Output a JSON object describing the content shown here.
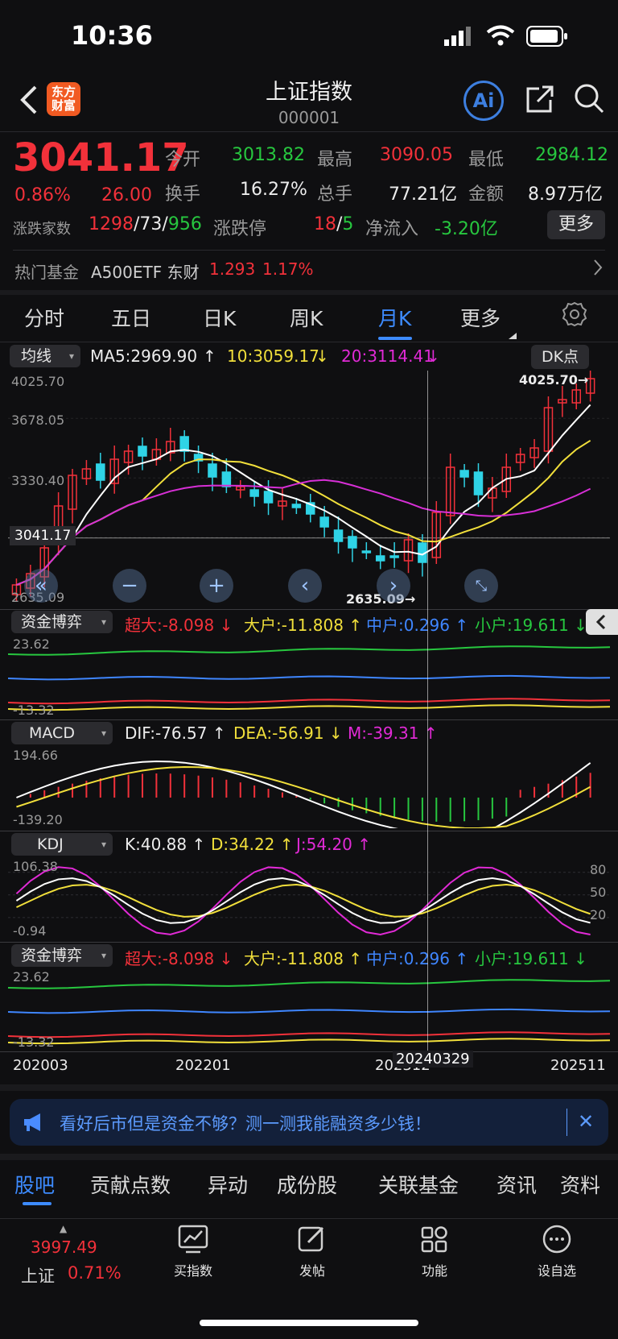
{
  "status": {
    "time": "10:36"
  },
  "header": {
    "title": "上证指数",
    "code": "000001",
    "logo": "东方\n财富",
    "ai": "Ai"
  },
  "quote": {
    "price": "3041.17",
    "pct": "0.86%",
    "chg": "26.00",
    "open_label": "今开",
    "open": "3013.82",
    "high_label": "最高",
    "high": "3090.05",
    "low_label": "最低",
    "low": "2984.12",
    "turnover_label": "换手",
    "turnover": "16.27%",
    "vol_label": "总手",
    "vol": "77.21亿",
    "amt_label": "金额",
    "amt": "8.97万亿",
    "adv_label": "涨跌家数",
    "adv_up": "1298",
    "adv_flat": "73",
    "adv_down": "956",
    "limit_label": "涨跌停",
    "limit_up": "18",
    "limit_down": "5",
    "inflow_label": "净流入",
    "inflow": "-3.20亿",
    "more": "更多"
  },
  "hot_fund": {
    "label": "热门基金",
    "name": "A500ETF 东财",
    "price": "1.293",
    "pct": "1.17%"
  },
  "tabs": [
    {
      "label": "分时"
    },
    {
      "label": "五日"
    },
    {
      "label": "日K"
    },
    {
      "label": "周K"
    },
    {
      "label": "月K"
    },
    {
      "label": "更多"
    }
  ],
  "ma": {
    "selector": "均线",
    "ma5": "MA5:2969.90",
    "ma10": "10:3059.17",
    "ma20": "20:3114.41",
    "dk": "DK点"
  },
  "main_chart": {
    "ymax": "4025.70",
    "y2": "3678.05",
    "y3": "3330.40",
    "ymin": "2635.09",
    "cross": "3041.17",
    "high_tag": "4025.70",
    "low_tag": "2635.09"
  },
  "fund1": {
    "selector": "资金博弈",
    "big": "超大:-8.098",
    "large": "大户:-11.808",
    "mid": "中户:0.296",
    "small": "小户:19.611",
    "ymax": "23.62",
    "ymin": "-13.32"
  },
  "macd": {
    "selector": "MACD",
    "dif": "DIF:-76.57",
    "dea": "DEA:-56.91",
    "m": "M:-39.31",
    "ymax": "194.66",
    "ymin": "-139.20"
  },
  "kdj": {
    "selector": "KDJ",
    "k": "K:40.88",
    "d": "D:34.22",
    "j": "J:54.20",
    "ymax": "106.38",
    "ymin": "-0.94",
    "l80": "80",
    "l50": "50",
    "l20": "20"
  },
  "fund2": {
    "selector": "资金博弈",
    "big": "超大:-8.098",
    "large": "大户:-11.808",
    "mid": "中户:0.296",
    "small": "小户:19.611",
    "ymax": "23.62",
    "ymin": "-13.32"
  },
  "xaxis": {
    "d1": "202003",
    "d2": "202201",
    "d3": "202312",
    "cursor": "20240329",
    "d4": "202511"
  },
  "banner": {
    "text": "看好后市但是资金不够？测一测我能融资多少钱！"
  },
  "bottom_tabs": [
    {
      "label": "股吧"
    },
    {
      "label": "贡献点数"
    },
    {
      "label": "异动"
    },
    {
      "label": "成份股"
    },
    {
      "label": "关联基金"
    },
    {
      "label": "资讯"
    },
    {
      "label": "资料"
    }
  ],
  "nav": {
    "index_price": "3997.49",
    "index_name": "上证",
    "index_pct": "0.71%",
    "buy": "买指数",
    "post": "发帖",
    "func": "功能",
    "watch": "设自选"
  },
  "chart_data": {
    "type": "candlestick",
    "closes": [
      2750,
      2820,
      2980,
      3240,
      3430,
      3470,
      3400,
      3530,
      3580,
      3550,
      3590,
      3640,
      3580,
      3520,
      3420,
      3360,
      3360,
      3300,
      3260,
      3270,
      3230,
      3190,
      3110,
      3020,
      2980,
      2950,
      2900,
      2920,
      3030,
      2890,
      3200,
      3480,
      3420,
      3310,
      3350,
      3480,
      3560,
      3600,
      3850,
      3900,
      3960,
      4030
    ],
    "colors": {
      "up": "#f2313a",
      "down": "#2fd3e6",
      "ma5": "#ffffff",
      "ma10": "#f1df3b",
      "ma20": "#d72fd6"
    }
  }
}
